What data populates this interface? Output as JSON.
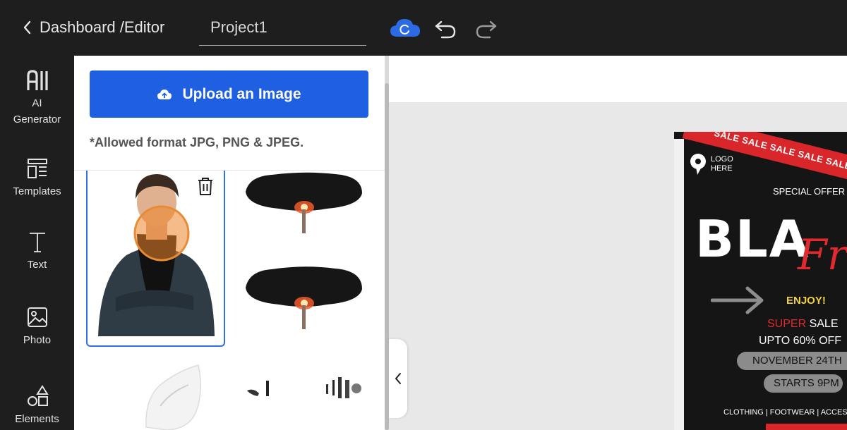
{
  "header": {
    "breadcrumb": "Dashboard /Editor",
    "project_name": "Project1"
  },
  "sidebar": {
    "items": [
      {
        "label": "AI\nGenerator",
        "icon": "ai-generator-icon"
      },
      {
        "label": "Templates",
        "icon": "templates-icon"
      },
      {
        "label": "Text",
        "icon": "text-icon"
      },
      {
        "label": "Photo",
        "icon": "photo-icon"
      },
      {
        "label": "Elements",
        "icon": "elements-icon"
      }
    ]
  },
  "upload_panel": {
    "button_label": "Upload an Image",
    "formats_note": "*Allowed format JPG, PNG & JPEG."
  },
  "poster": {
    "ribbon": "SALE SALE SALE SALE SALE SALE",
    "logo_line1": "LOGO",
    "logo_line2": "HERE",
    "special": "SPECIAL OFFER",
    "headline": "BLA",
    "script": "Fr",
    "enjoy": "ENJOY!",
    "super_red": "SUPER",
    "super_white": " SALE",
    "upto": "UPTO 60% OFF",
    "date": "NOVEMBER 24TH",
    "starts": "STARTS 9PM",
    "categories": "CLOTHING | FOOTWEAR | ACCESSO"
  },
  "colors": {
    "accent": "#1f5fe2",
    "sale_red": "#d8262a",
    "enjoy_yellow": "#f2d23a"
  }
}
